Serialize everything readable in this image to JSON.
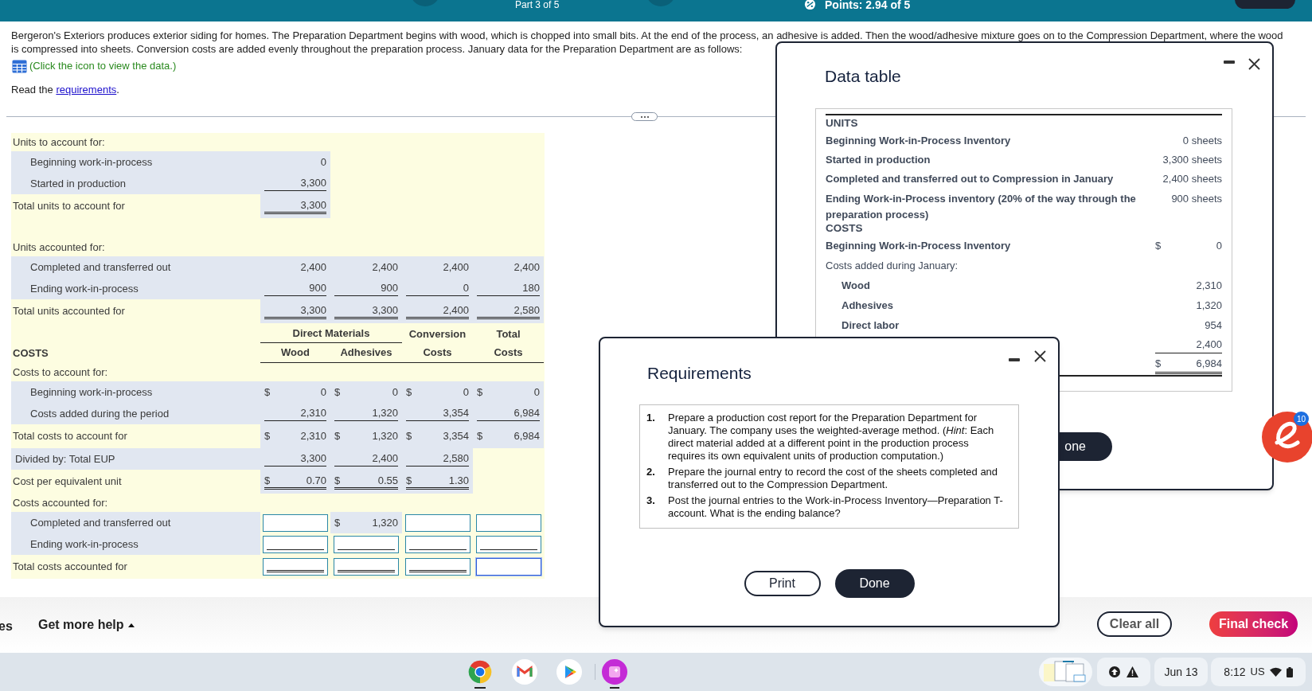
{
  "top_bar": {
    "part": "Part 3 of 5",
    "points": "Points: 2.94 of 5"
  },
  "intro": {
    "text": "Bergeron's Exteriors produces exterior siding for homes. The Preparation Department begins with wood, which is chopped into small bits. At the end of the process, an adhesive is added. Then the wood/adhesive mixture goes on to the Compression Department, where the wood is compressed into sheets. Conversion costs are added evenly throughout the preparation process. January data for the Preparation Department are as follows:",
    "data_link": "(Click the icon to view the data.)",
    "read_prefix": "Read the ",
    "read_link": "requirements",
    "read_suffix": "."
  },
  "worksheet": {
    "blocks": [
      {
        "rows": [
          {
            "kind": "heading",
            "label": "Units to account for:"
          },
          {
            "kind": "item",
            "label": "Beginning work-in-process",
            "cells": [
              {
                "kind": "amount",
                "value": "0"
              }
            ]
          },
          {
            "kind": "item",
            "label": "Started in production",
            "cells": [
              {
                "kind": "amount",
                "value": "3,300",
                "underline": true
              }
            ]
          },
          {
            "kind": "total",
            "label": "Total units to account for",
            "cells": [
              {
                "kind": "amount",
                "value": "3,300",
                "double_underline": true
              }
            ]
          }
        ]
      },
      {
        "rows": [
          {
            "kind": "heading",
            "label": "Units accounted for:"
          },
          {
            "kind": "item",
            "label": "Completed and transferred out",
            "cells": [
              {
                "kind": "amount",
                "value": "2,400"
              },
              {
                "kind": "amount",
                "value": "2,400"
              },
              {
                "kind": "amount",
                "value": "2,400"
              },
              {
                "kind": "amount",
                "value": "2,400"
              }
            ]
          },
          {
            "kind": "item",
            "label": "Ending work-in-process",
            "cells": [
              {
                "kind": "amount",
                "value": "900",
                "underline": true
              },
              {
                "kind": "amount",
                "value": "900",
                "underline": true
              },
              {
                "kind": "amount",
                "value": "0",
                "underline": true
              },
              {
                "kind": "amount",
                "value": "180",
                "underline": true
              }
            ]
          },
          {
            "kind": "total",
            "label": "Total units accounted for",
            "cells": [
              {
                "kind": "amount",
                "value": "3,300",
                "double_underline": true
              },
              {
                "kind": "amount",
                "value": "3,300",
                "double_underline": true
              },
              {
                "kind": "amount",
                "value": "2,400",
                "double_underline": true
              },
              {
                "kind": "amount",
                "value": "2,580",
                "double_underline": true
              }
            ]
          },
          {
            "kind": "heads",
            "label": "COSTS",
            "group": "Direct Materials",
            "columns": [
              {
                "bottom": "Wood"
              },
              {
                "bottom": "Adhesives"
              },
              {
                "top": "Conversion",
                "bottom": "Costs"
              },
              {
                "top": "Total",
                "bottom": "Costs"
              }
            ]
          },
          {
            "kind": "heading",
            "label": "Costs to account for:"
          },
          {
            "kind": "item",
            "label": "Beginning work-in-process",
            "cells": [
              {
                "kind": "amount",
                "dollar": "$",
                "value": "0"
              },
              {
                "kind": "amount",
                "dollar": "$",
                "value": "0"
              },
              {
                "kind": "amount",
                "dollar": "$",
                "value": "0"
              },
              {
                "kind": "amount",
                "dollar": "$",
                "value": "0"
              }
            ]
          },
          {
            "kind": "item",
            "label": "Costs added during the period",
            "cells": [
              {
                "kind": "amount",
                "value": "2,310",
                "underline": true
              },
              {
                "kind": "amount",
                "value": "1,320",
                "underline": true
              },
              {
                "kind": "amount",
                "value": "3,354",
                "underline": true
              },
              {
                "kind": "amount",
                "value": "6,984",
                "underline": true
              }
            ]
          },
          {
            "kind": "total",
            "label": "Total costs to account for",
            "cells": [
              {
                "kind": "amount",
                "dollar": "$",
                "value": "2,310"
              },
              {
                "kind": "amount",
                "dollar": "$",
                "value": "1,320"
              },
              {
                "kind": "amount",
                "dollar": "$",
                "value": "3,354"
              },
              {
                "kind": "amount",
                "dollar": "$",
                "value": "6,984"
              }
            ]
          },
          {
            "kind": "line",
            "label": "Divided by: Total EUP",
            "cells": [
              {
                "kind": "amount",
                "value": "3,300",
                "underline": true
              },
              {
                "kind": "amount",
                "value": "2,400",
                "underline": true
              },
              {
                "kind": "amount",
                "value": "2,580",
                "underline": true
              }
            ]
          },
          {
            "kind": "total",
            "label": "Cost per equivalent unit",
            "cells": [
              {
                "kind": "amount",
                "dollar": "$",
                "value": "0.70",
                "double_underline": true
              },
              {
                "kind": "amount",
                "dollar": "$",
                "value": "0.55",
                "double_underline": true
              },
              {
                "kind": "amount",
                "dollar": "$",
                "value": "1.30",
                "double_underline": true
              }
            ]
          },
          {
            "kind": "heading",
            "label": "Costs accounted for:"
          },
          {
            "kind": "item",
            "label": "Completed and transferred out",
            "cells": [
              {
                "kind": "input",
                "focused": false
              },
              {
                "kind": "amount",
                "dollar": "$",
                "value": "1,320"
              },
              {
                "kind": "input",
                "focused": false
              },
              {
                "kind": "input",
                "focused": false
              }
            ]
          },
          {
            "kind": "item",
            "label": "Ending work-in-process",
            "cells": [
              {
                "kind": "input",
                "underline": true,
                "focused": false
              },
              {
                "kind": "input",
                "underline": true,
                "focused": false
              },
              {
                "kind": "input",
                "underline": true,
                "focused": false
              },
              {
                "kind": "input",
                "underline": true,
                "focused": false
              }
            ]
          },
          {
            "kind": "total",
            "label": "Total costs accounted for",
            "cells": [
              {
                "kind": "input",
                "double_underline": true,
                "focused": false
              },
              {
                "kind": "input",
                "double_underline": true,
                "focused": false
              },
              {
                "kind": "input",
                "double_underline": true,
                "focused": false
              },
              {
                "kind": "input",
                "focused": true
              }
            ]
          }
        ]
      }
    ]
  },
  "data_table": {
    "title": "Data table",
    "rows": [
      {
        "kind": "section",
        "label": "UNITS"
      },
      {
        "kind": "bold",
        "label": "Beginning Work-in-Process Inventory",
        "value": "0 sheets"
      },
      {
        "kind": "bold",
        "label": "Started in production",
        "value": "3,300 sheets"
      },
      {
        "kind": "bold",
        "label": "Completed and transferred out to Compression in January",
        "value": "2,400 sheets"
      },
      {
        "kind": "bold",
        "label": "Ending Work-in-Process inventory (20% of the way through the preparation process)",
        "value": "900 sheets"
      },
      {
        "kind": "section",
        "label": "COSTS"
      },
      {
        "kind": "bold",
        "label": "Beginning Work-in-Process Inventory",
        "dollar": "$",
        "value": "0"
      },
      {
        "kind": "plain",
        "label": "Costs added during January:"
      },
      {
        "kind": "sub",
        "label": "Wood",
        "value": "2,310"
      },
      {
        "kind": "sub",
        "label": "Adhesives",
        "value": "1,320"
      },
      {
        "kind": "sub",
        "label": "Direct labor",
        "value": "954"
      },
      {
        "kind": "sub",
        "value": "2,400",
        "underline": true
      },
      {
        "kind": "sub",
        "dollar": "$",
        "value": "6,984",
        "double_underline": true
      }
    ],
    "done": "one"
  },
  "requirements": {
    "title": "Requirements",
    "items": [
      {
        "number": "1.",
        "text": "Prepare a production cost report for the Preparation Department for January. The company uses the weighted-average method. (*Hint*: Each direct material added at a different point in the production process requires its own equivalent units of production computation.)"
      },
      {
        "number": "2.",
        "text": "Prepare the journal entry to record the cost of the sheets completed and transferred out to the Compression Department."
      },
      {
        "number": "3.",
        "text": "Post the journal entries to the Work-in-Process Inventory—Preparation T-account. What is the ending balance?"
      }
    ],
    "buttons": [
      {
        "label": "Print",
        "kind": "secondary"
      },
      {
        "label": "Done",
        "kind": "primary"
      }
    ]
  },
  "assistant": {
    "badge": "10"
  },
  "footer": {
    "cut_text": "es",
    "help": "Get more help",
    "buttons": [
      {
        "label": "Clear all",
        "kind": "secondary"
      },
      {
        "label": "Final check",
        "kind": "primary"
      }
    ]
  },
  "taskbar": {
    "date": "Jun 13",
    "time": "8:12",
    "locale": "US"
  }
}
